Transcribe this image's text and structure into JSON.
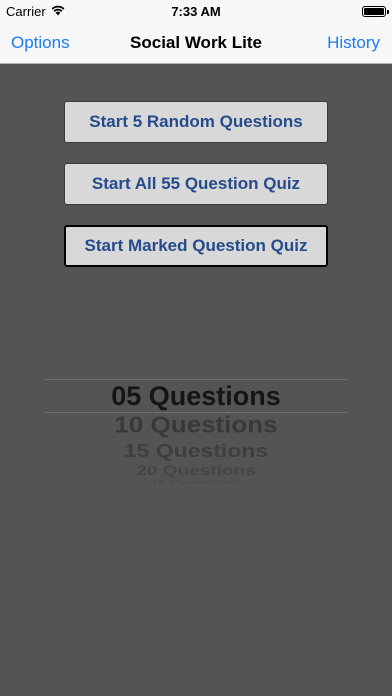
{
  "status_bar": {
    "carrier": "Carrier",
    "wifi_icon": "wifi-icon",
    "time": "7:33 AM",
    "battery_icon": "battery-icon"
  },
  "nav_bar": {
    "left_label": "Options",
    "title": "Social Work Lite",
    "right_label": "History"
  },
  "buttons": {
    "random_label": "Start 5 Random Questions",
    "all_label": "Start All 55 Question Quiz",
    "marked_label": "Start Marked Question Quiz"
  },
  "picker": {
    "selected": "05 Questions",
    "options": [
      "05 Questions",
      "10 Questions",
      "15 Questions",
      "20 Questions",
      "25 Questions"
    ]
  },
  "colors": {
    "background": "#545454",
    "nav_tint": "#1a7cf6",
    "button_text": "#264b8c",
    "button_fill": "#d8d8d8"
  }
}
